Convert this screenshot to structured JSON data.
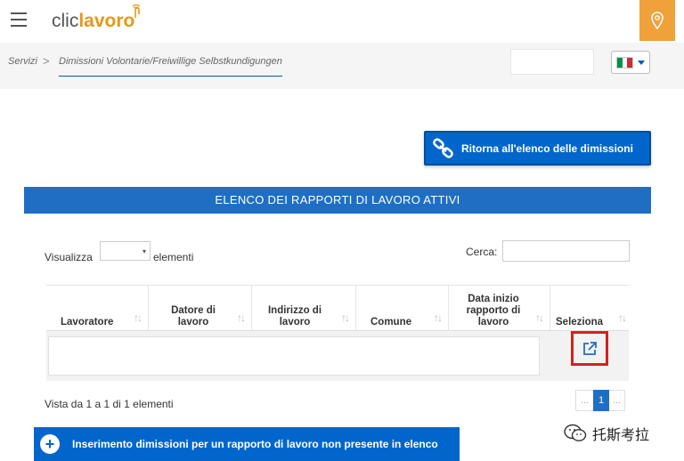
{
  "header": {
    "logo_part1": "clic",
    "logo_part2": "lavoro"
  },
  "breadcrumb": {
    "item1": "Servizi",
    "separator": ">",
    "item2": "Dimissioni Volontarie/Freiwillige Selbstkundigungen"
  },
  "language": {
    "flag_colors": [
      "#009246",
      "#ffffff",
      "#ce2b37"
    ]
  },
  "return_button": {
    "label": "Ritorna all'elenco delle dimissioni"
  },
  "section_title": "ELENCO DEI RAPPORTI DI LAVORO ATTIVI",
  "controls": {
    "show_label": "Visualizza",
    "show_suffix": "elementi",
    "show_value": "▾",
    "search_label": "Cerca:"
  },
  "table": {
    "columns": [
      {
        "label": "Lavoratore",
        "sort": "↑↓"
      },
      {
        "label": "Datore di lavoro",
        "sort": "↑↓"
      },
      {
        "label": "Indirizzo di lavoro",
        "sort": "↑↓"
      },
      {
        "label": "Comune",
        "sort": "↑↓"
      },
      {
        "label": "Data inizio rapporto di lavoro",
        "sort": "↑↓"
      },
      {
        "label": "Seleziona",
        "sort": "↑↓"
      }
    ]
  },
  "footer": {
    "info": "Vista da 1 a 1 di 1 elementi",
    "pager_prev": "...",
    "pager_current": "1",
    "pager_next": "..."
  },
  "add_button": {
    "icon": "+",
    "label": "Inserimento dimissioni per un rapporto di lavoro non presente in elenco"
  },
  "watermark": {
    "text": "托斯考拉"
  },
  "colors": {
    "primary_blue": "#0066cc",
    "header_blue": "#1e6fc4",
    "accent_orange": "#f0a13a",
    "highlight_red": "#d42020"
  }
}
